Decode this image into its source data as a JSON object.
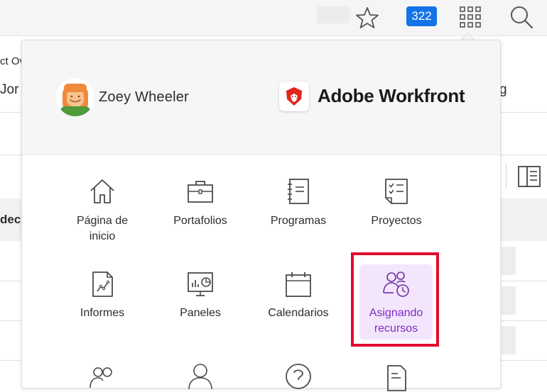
{
  "topbar": {
    "notification_count": "322",
    "star_icon": "star-icon",
    "apps_icon": "grid-apps-icon",
    "search_icon": "search-icon"
  },
  "background": {
    "row1": "ct Ov",
    "row2": "Jor",
    "row2_right": "g",
    "header": "dec"
  },
  "panel": {
    "user": {
      "name": "Zoey Wheeler"
    },
    "brand": "Adobe Workfront",
    "tiles": [
      {
        "label": "Página de inicio",
        "icon": "home-icon"
      },
      {
        "label": "Portafolios",
        "icon": "briefcase-icon"
      },
      {
        "label": "Programas",
        "icon": "notebook-icon"
      },
      {
        "label": "Proyectos",
        "icon": "clipboard-checklist-icon"
      },
      {
        "label": "Informes",
        "icon": "report-document-icon"
      },
      {
        "label": "Paneles",
        "icon": "dashboard-icon"
      },
      {
        "label": "Calendarios",
        "icon": "calendar-icon"
      },
      {
        "label": "Asignando recursos",
        "icon": "resource-people-clock-icon",
        "active": true
      },
      {
        "label": "",
        "icon": "team-icon"
      },
      {
        "label": "",
        "icon": "user-icon"
      },
      {
        "label": "",
        "icon": "help-icon"
      },
      {
        "label": "",
        "icon": "document-list-icon"
      }
    ]
  },
  "colors": {
    "accent_badge": "#1473e6",
    "active_tile_bg": "#f3e6fc",
    "active_tile_text": "#7e2cc5",
    "highlight_border": "#e20c2e"
  }
}
